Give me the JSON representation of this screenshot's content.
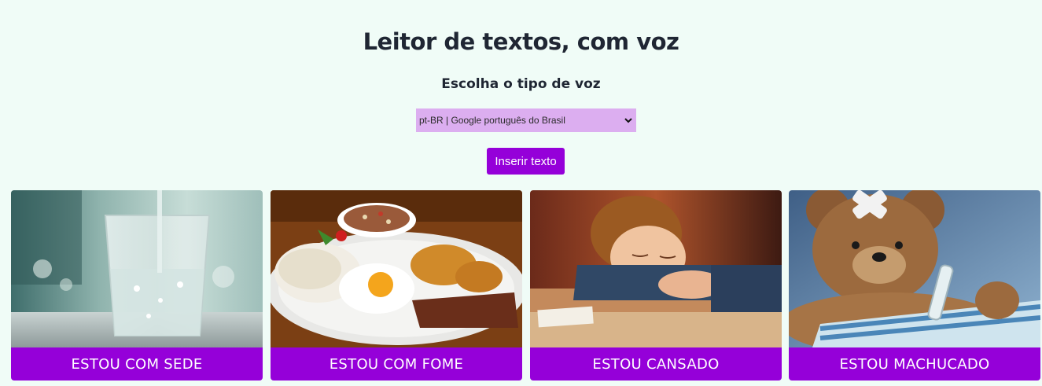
{
  "page": {
    "title": "Leitor de textos, com voz",
    "subtitle": "Escolha o tipo de voz"
  },
  "voice_select": {
    "selected": "pt-BR | Google português do Brasil",
    "icon": "chevron-down-icon"
  },
  "insert_button": {
    "label": "Inserir texto"
  },
  "cards": [
    {
      "label": "ESTOU COM SEDE",
      "image": "glass-of-water"
    },
    {
      "label": "ESTOU COM FOME",
      "image": "plate-of-food"
    },
    {
      "label": "ESTOU CANSADO",
      "image": "sleeping-child"
    },
    {
      "label": "ESTOU MACHUCADO",
      "image": "hurt-teddy-bear"
    }
  ],
  "colors": {
    "background": "#f0fcf7",
    "accent": "#9500d9",
    "select_bg": "#dcaef0",
    "text": "#1f2633"
  }
}
